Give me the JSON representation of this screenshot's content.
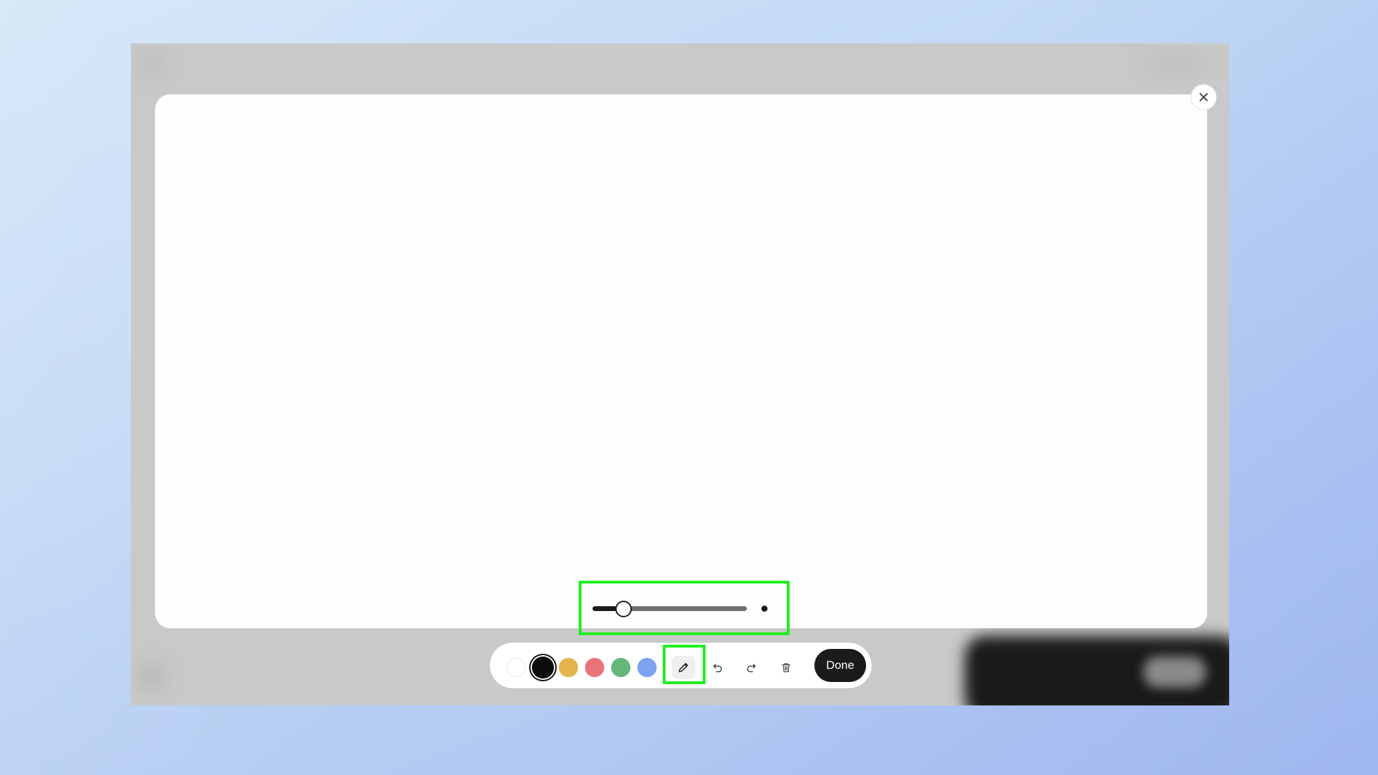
{
  "drawing_modal": {
    "close_icon": "close-icon",
    "stroke_size": {
      "level": 0.2,
      "preview_icon": "dot"
    },
    "toolbar": {
      "colors": [
        {
          "name": "white",
          "hex": "#ffffff",
          "selected": false
        },
        {
          "name": "black",
          "hex": "#0d0d0d",
          "selected": true
        },
        {
          "name": "yellow",
          "hex": "#e3b44c",
          "selected": false
        },
        {
          "name": "red",
          "hex": "#e9737b",
          "selected": false
        },
        {
          "name": "green",
          "hex": "#66b77b",
          "selected": false
        },
        {
          "name": "blue",
          "hex": "#7ea3f2",
          "selected": false
        }
      ],
      "tools": [
        {
          "name": "pencil-icon",
          "active": true
        },
        {
          "name": "undo-icon",
          "active": false
        },
        {
          "name": "redo-icon",
          "active": false
        },
        {
          "name": "trash-icon",
          "active": false
        }
      ],
      "done_label": "Done"
    },
    "highlight_color": "#1ef01e"
  }
}
